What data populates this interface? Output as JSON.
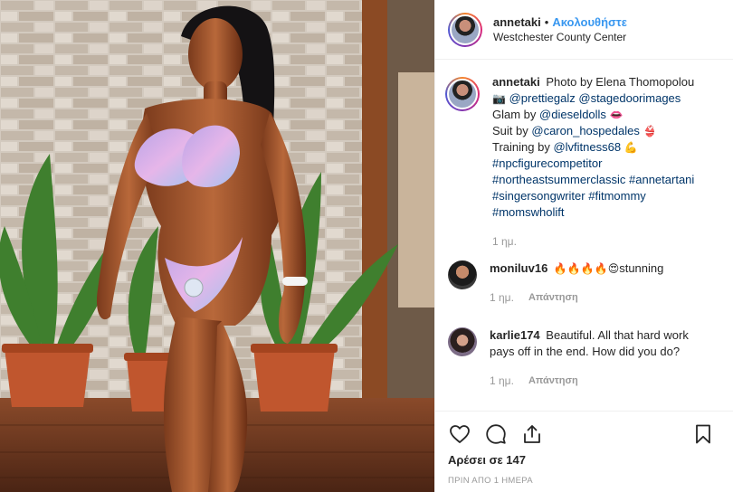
{
  "post": {
    "username": "annetaki",
    "follow_label": "Ακολουθήστε",
    "location": "Westchester County Center"
  },
  "caption": {
    "username": "annetaki",
    "line1": "Photo by Elena Thomopolou",
    "camera_emoji": "📷",
    "photo_tags": "@prettiegalz @stagedoorimages",
    "glam_prefix": "Glam by",
    "glam_tag": "@dieseldolls",
    "glam_emoji": "👄",
    "suit_prefix": "Suit by",
    "suit_tag": "@caron_hospedales",
    "suit_emoji": "👙",
    "training_prefix": "Training by",
    "training_tag": "@lvfitness68",
    "training_emoji": "💪",
    "hashtags": [
      "#npcfigurecompetitor",
      "#northeastsummerclassic",
      "#annetartani",
      "#singersongwriter",
      "#fitmommy",
      "#momswholift"
    ],
    "age": "1 ημ."
  },
  "comments": [
    {
      "username": "moniluv16",
      "emojis": "🔥🔥🔥🔥😍",
      "text": "stunning",
      "age": "1 ημ.",
      "reply_label": "Απάντηση"
    },
    {
      "username": "karlie174",
      "text": "Beautiful. All that hard work pays off in the end. How did you do?",
      "age": "1 ημ.",
      "reply_label": "Απάντηση"
    }
  ],
  "actions": {
    "like_icon": "heart-icon",
    "comment_icon": "comment-icon",
    "share_icon": "share-icon",
    "save_icon": "bookmark-icon",
    "likes_text": "Αρέσει σε 147",
    "timestamp": "ΠΡΙΝ ΑΠΟ 1 ΗΜΕΡΑ"
  },
  "colors": {
    "link": "#003569",
    "follow": "#3897f0",
    "muted": "#999999"
  }
}
